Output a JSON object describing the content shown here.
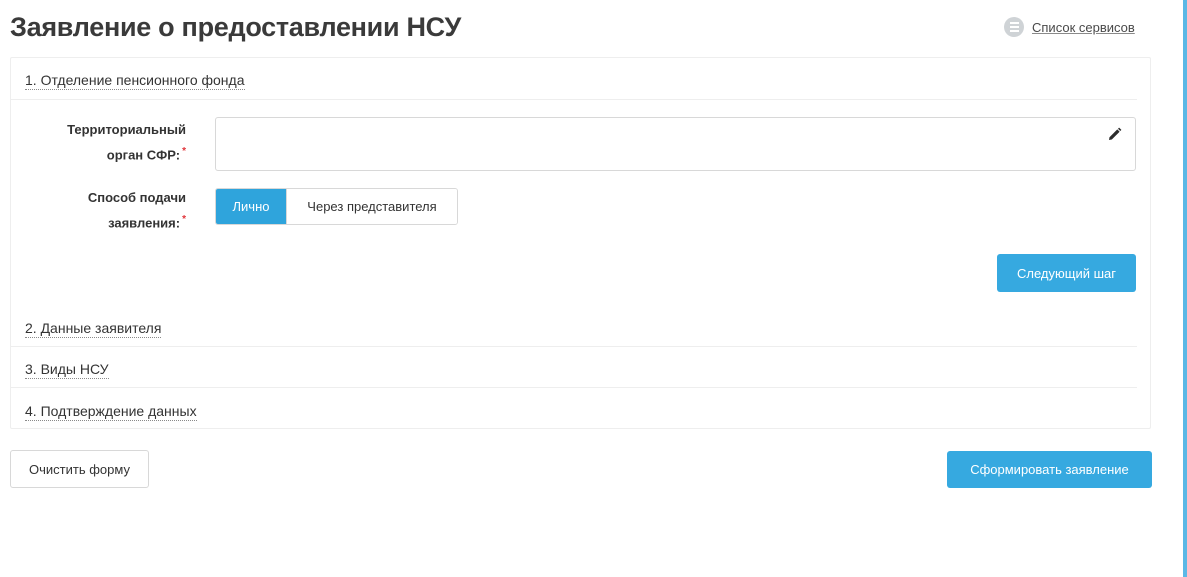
{
  "page": {
    "title": "Заявление о предоставлении НСУ",
    "services_link": "Список сервисов"
  },
  "sections": [
    {
      "label": "1. Отделение пенсионного фонда"
    },
    {
      "label": "2. Данные заявителя"
    },
    {
      "label": "3. Виды НСУ"
    },
    {
      "label": "4. Подтверждение данных"
    }
  ],
  "form": {
    "territory": {
      "label_line1": "Территориальный",
      "label_line2": "орган СФР:",
      "required_mark": "*",
      "value": ""
    },
    "submission": {
      "label_line1": "Способ подачи",
      "label_line2": "заявления:",
      "required_mark": "*",
      "options": [
        "Лично",
        "Через представителя"
      ],
      "selected": "Лично"
    }
  },
  "buttons": {
    "next_step": "Следующий шаг",
    "clear_form": "Очистить форму",
    "generate": "Сформировать заявление"
  },
  "icons": {
    "services": "list-icon",
    "edit": "pencil-icon"
  },
  "colors": {
    "accent": "#36a9e0",
    "required": "#e0343a"
  }
}
